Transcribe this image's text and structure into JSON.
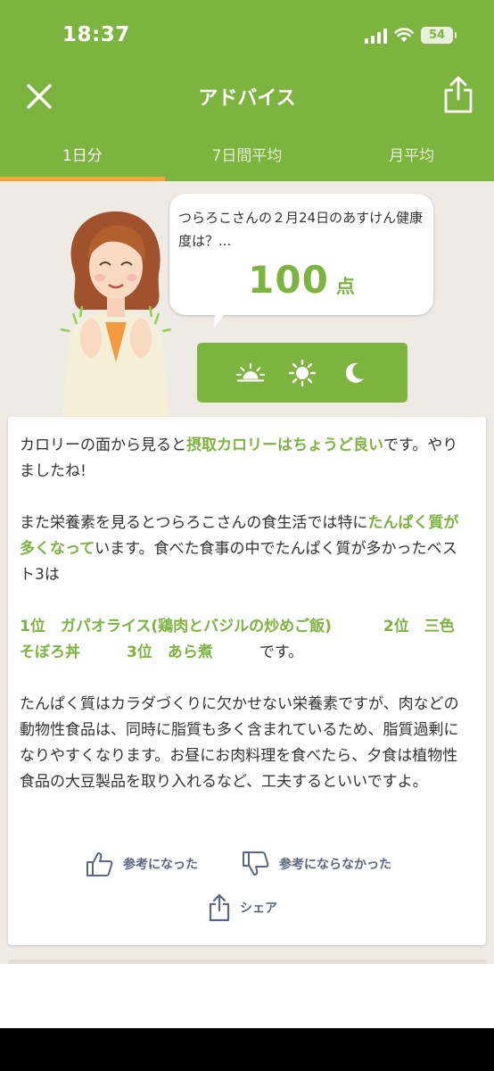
{
  "status_bar": {
    "time": "18:37",
    "battery": "54"
  },
  "navbar": {
    "title": "アドバイス",
    "close_icon": "close-icon",
    "share_icon": "share-icon"
  },
  "tabs": [
    {
      "label": "1日分",
      "active": true
    },
    {
      "label": "7日間平均",
      "active": false
    },
    {
      "label": "月平均",
      "active": false
    }
  ],
  "bubble": {
    "question": "つらろこさんの２月24日のあすけん健康度は？...",
    "score": "100",
    "unit": "点"
  },
  "time_of_day": [
    "sunrise-icon",
    "sun-icon",
    "moon-icon"
  ],
  "advice": {
    "p1_a": "カロリーの面から見ると",
    "p1_hl": "摂取カロリーはちょうど良い",
    "p1_b": "です。やりましたね!",
    "p2_a": "また栄養素を見るとつらろこさんの食生活では特に",
    "p2_hl": "たんぱく質が多くなって",
    "p2_b": "います。食べた食事の中でたんぱく質が多かったベスト3は",
    "p3_rank1": "1位　ガパオライス(鶏肉とバジルの炒めご飯)",
    "p3_rank2": "2位　三色そぼろ丼",
    "p3_rank3": "3位　あら煮",
    "p3_tail": "です。",
    "p4": "たんぱく質はカラダづくりに欠かせない栄養素ですが、肉などの動物性食品は、同時に脂質も多く含まれているため、脂質過剰になりやすくなります。お昼にお肉料理を食べたら、夕食は植物性食品の大豆製品を取り入れるなど、工夫するといいですよ。"
  },
  "feedback": {
    "helpful": "参考になった",
    "not_helpful": "参考にならなかった",
    "share": "シェア"
  },
  "colors": {
    "brand_green": "#7db33f",
    "tab_indicator": "#f3a43b",
    "background": "#efebe4"
  }
}
